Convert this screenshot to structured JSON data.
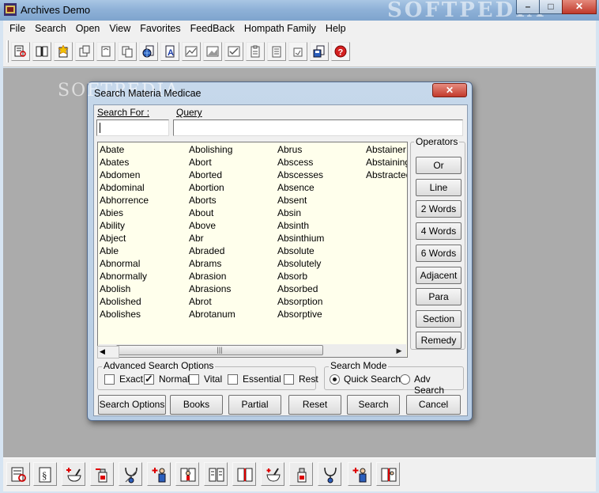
{
  "window": {
    "title": "Archives Demo",
    "watermark": "SOFTPEDIA",
    "minimize_glyph": "–",
    "maximize_glyph": "□",
    "close_glyph": "✕"
  },
  "menu": [
    "File",
    "Search",
    "Open",
    "View",
    "Favorites",
    "FeedBack",
    "Hompath Family",
    "Help"
  ],
  "toolbar_icons": [
    "book-search-icon",
    "open-book-icon",
    "new-star-icon",
    "document-icon",
    "page-icon",
    "copy-icon",
    "globe-document-icon",
    "letter-a-icon",
    "graph-icon",
    "image-icon",
    "check-image-icon",
    "clipboard-icon",
    "notes-icon",
    "small-doc-icon",
    "save-icon",
    "help-icon"
  ],
  "bottom_icons": [
    "book-search-icon",
    "book-section-icon",
    "mortar-plus-icon",
    "medicine-plus-icon",
    "stethoscope-icon",
    "person-plus-icon",
    "book-person-icon",
    "open-book-icon",
    "open-book-red-icon",
    "mortar-icon",
    "medicine-bottle-icon",
    "stethoscope-icon",
    "person-plus-icon",
    "book-person-icon"
  ],
  "dialog": {
    "title": "Search Materia Medicae",
    "watermark": "SOFTPEDIA",
    "close_glyph": "✕",
    "search_for_label": "Search For :",
    "search_for_value": "",
    "query_label": "Query",
    "query_value": "",
    "word_columns": [
      [
        "Abate",
        "Abates",
        "Abdomen",
        "Abdominal",
        "Abhorrence",
        "Abies",
        "Ability",
        "Abject",
        "Able",
        "Abnormal",
        "Abnormally",
        "Abolish",
        "Abolished",
        "Abolishes"
      ],
      [
        "Abolishing",
        "Abort",
        "Aborted",
        "Abortion",
        "Aborts",
        "About",
        "Above",
        "Abr",
        "Abraded",
        "Abrams",
        "Abrasion",
        "Abrasions",
        "Abrot",
        "Abrotanum"
      ],
      [
        "Abrus",
        "Abscess",
        "Abscesses",
        "Absence",
        "Absent",
        "Absin",
        "Absinth",
        "Absinthium",
        "Absolute",
        "Absolutely",
        "Absorb",
        "Absorbed",
        "Absorption",
        "Absorptive"
      ],
      [
        "Abstainer",
        "Abstaining",
        "Abstracted"
      ]
    ],
    "scroll_thumb_glyph": "|||",
    "operators": {
      "label": "Operators",
      "buttons": [
        "Or",
        "Line",
        "2 Words",
        "4 Words",
        "6 Words",
        "Adjacent",
        "Para",
        "Section",
        "Remedy"
      ]
    },
    "advanced": {
      "label": "Advanced Search Options",
      "options": [
        {
          "label": "Exact",
          "checked": false
        },
        {
          "label": "Normal",
          "checked": true
        },
        {
          "label": "Vital",
          "checked": false
        },
        {
          "label": "Essential",
          "checked": false
        },
        {
          "label": "Rest",
          "checked": false
        }
      ]
    },
    "search_mode": {
      "label": "Search Mode",
      "options": [
        {
          "label": "Quick Search",
          "selected": true
        },
        {
          "label": "Adv Search",
          "selected": false
        }
      ]
    },
    "buttons": [
      "Search Options",
      "Books",
      "Partial",
      "Reset",
      "Search",
      "Cancel"
    ]
  }
}
